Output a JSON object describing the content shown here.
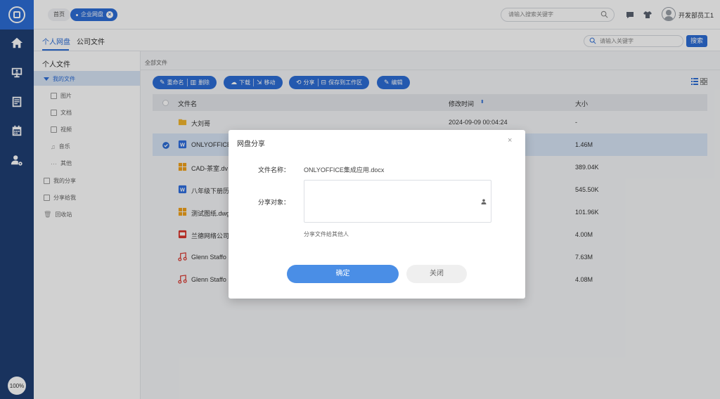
{
  "rail": {
    "zoom_badge": "100%",
    "items": [
      "home-icon",
      "monitor-user-icon",
      "form-icon",
      "calendar-icon",
      "user-settings-icon"
    ]
  },
  "header": {
    "crumb_home": "首页",
    "crumb_tab": "企业网盘",
    "search_placeholder": "请输入搜索关键字",
    "user_name": "开发部员工1"
  },
  "subheader": {
    "tabs": [
      {
        "label": "个人网盘",
        "active": true
      },
      {
        "label": "公司文件",
        "active": false
      }
    ],
    "search_placeholder": "请输入关键字",
    "search_button": "搜索"
  },
  "sidebar": {
    "title": "个人文件",
    "items": [
      {
        "label": "我的文件"
      },
      {
        "label": "图片"
      },
      {
        "label": "文档"
      },
      {
        "label": "视频"
      },
      {
        "label": "音乐"
      },
      {
        "label": "其他"
      },
      {
        "label": "我的分享"
      },
      {
        "label": "分享给我"
      },
      {
        "label": "回收站"
      }
    ]
  },
  "main": {
    "breadcrumb": "全部文件",
    "toolbar": {
      "rename": "重命名",
      "delete": "删除",
      "download": "下载",
      "move": "移动",
      "share": "分享",
      "save_to_workbench": "保存到工作区",
      "edit": "编辑"
    },
    "table": {
      "columns": [
        "文件名",
        "修改时间",
        "大小"
      ],
      "rows": [
        {
          "name": "大刘哥",
          "modified": "2024-09-09 00:04:24",
          "size": "-",
          "icon": "folder-icon"
        },
        {
          "name": "ONLYOFFICE",
          "modified": "",
          "size": "1.46M",
          "icon": "word-doc-icon",
          "selected": true
        },
        {
          "name": "CAD-茶室.dv",
          "modified": "",
          "size": "389.04K",
          "icon": "cad-icon"
        },
        {
          "name": "八年级下册历",
          "modified": "",
          "size": "545.50K",
          "icon": "word-doc-icon"
        },
        {
          "name": "测试图纸.dwg",
          "modified": "",
          "size": "101.96K",
          "icon": "cad-icon"
        },
        {
          "name": "兰德网络公司",
          "modified": "",
          "size": "4.00M",
          "icon": "pdf-icon"
        },
        {
          "name": "Glenn Staffo",
          "modified": "",
          "size": "7.63M",
          "icon": "music-icon"
        },
        {
          "name": "Glenn Staffo",
          "modified": "",
          "size": "4.08M",
          "icon": "music-icon"
        }
      ]
    }
  },
  "modal": {
    "title": "网盘分享",
    "file_name_label": "文件名称：",
    "file_name_value": "ONLYOFFICE集成应用.docx",
    "share_target_label": "分享对象：",
    "hint": "分享文件给其他人",
    "confirm": "确定",
    "close": "关闭"
  },
  "colors": {
    "rail": "#1f3f73",
    "accent": "#2d6dd6",
    "selected_row": "#d7e4f6"
  }
}
